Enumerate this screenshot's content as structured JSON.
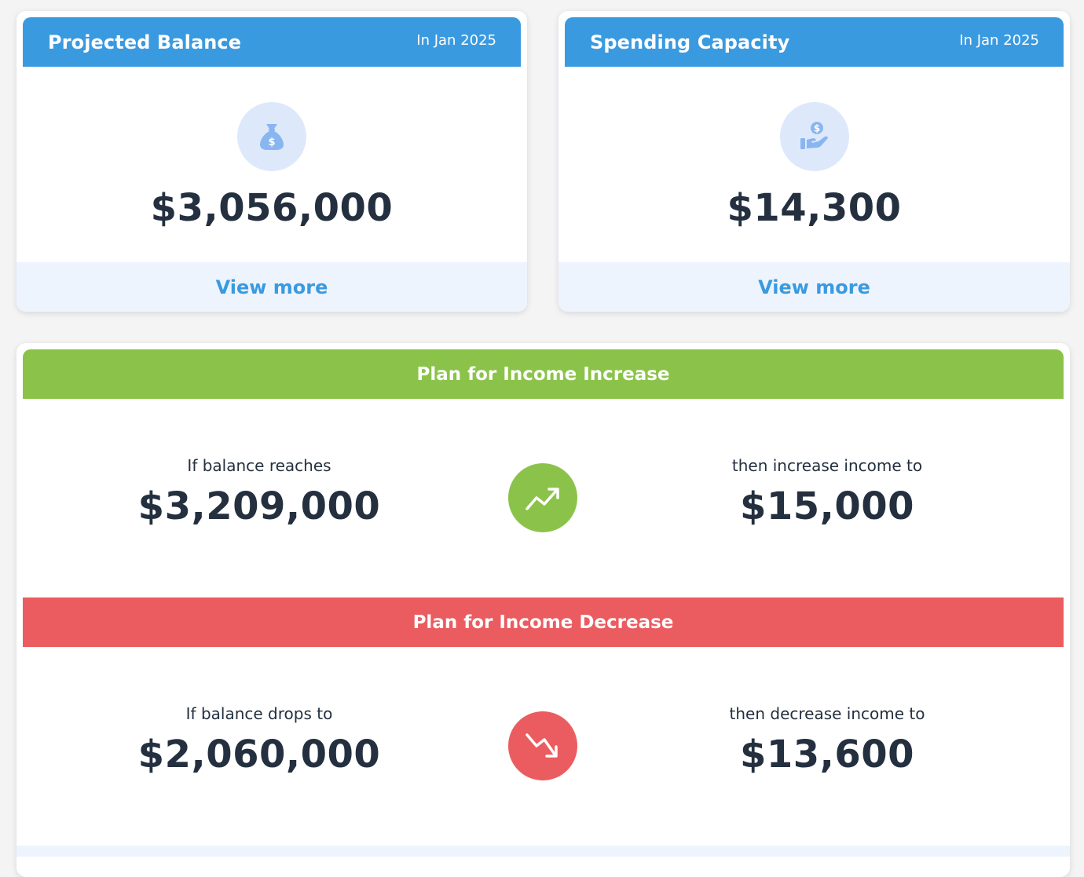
{
  "projected_balance": {
    "title": "Projected Balance",
    "date": "In Jan 2025",
    "icon": "money-bag-icon",
    "value": "$3,056,000",
    "link": "View more"
  },
  "spending_capacity": {
    "title": "Spending Capacity",
    "date": "In Jan 2025",
    "icon": "hand-dollar-icon",
    "value": "$14,300",
    "link": "View more"
  },
  "income_increase": {
    "title": "Plan for Income Increase",
    "left_label": "If balance reaches",
    "left_value": "$3,209,000",
    "icon": "trend-up-icon",
    "right_label": "then increase income to",
    "right_value": "$15,000"
  },
  "income_decrease": {
    "title": "Plan for Income Decrease",
    "left_label": "If balance drops to",
    "left_value": "$2,060,000",
    "icon": "trend-down-icon",
    "right_label": "then decrease income to",
    "right_value": "$13,600"
  },
  "colors": {
    "blue": "#3a9ae0",
    "green": "#8bc34a",
    "red": "#eb5c60",
    "text": "#24303f",
    "icon_bg": "#dde9fb"
  }
}
